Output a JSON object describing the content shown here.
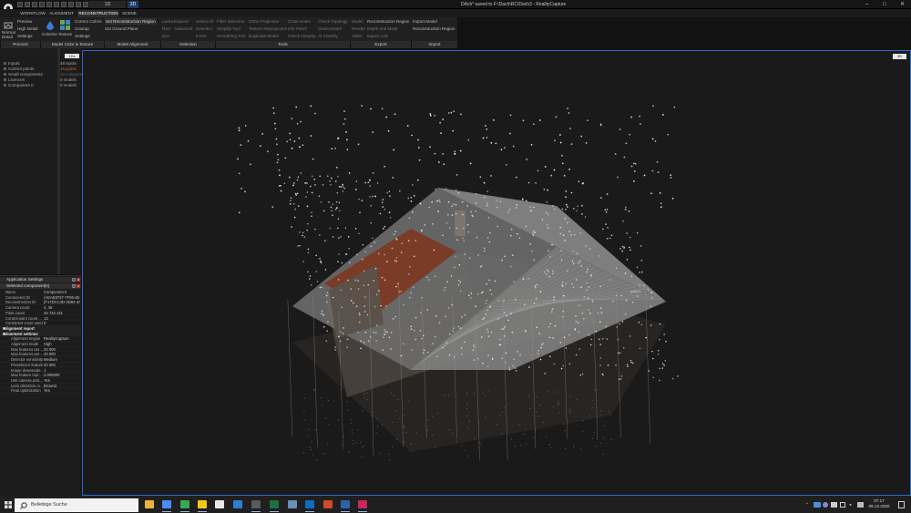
{
  "titlebar": {
    "title": "DAch* saved to F:\\Dach\\RC\\Dach3 - RealityCapture",
    "view_1d": "1D",
    "view_3d": "3D",
    "minimize": "–",
    "maximize": "□",
    "close": "✕"
  },
  "menu": {
    "tabs": [
      "WORKFLOW",
      "ALIGNMENT",
      "RECONSTRUCTION",
      "SCENE"
    ],
    "active_tab": "RECONSTRUCTION"
  },
  "ribbon": {
    "process": {
      "normal_detail": "Normal Detail",
      "preview": "Preview",
      "high_detail": "High Detail",
      "settings": "Settings",
      "group": "Process"
    },
    "model_color": {
      "colorize": "Colorize",
      "texture": "Texture",
      "correct_colors": "Correct Colors",
      "unwrap": "Unwrap",
      "settings": "Settings",
      "group": "Model Color & Texture"
    },
    "model_alignment": {
      "set_region": "Set Reconstruction Region",
      "set_ground": "Set Ground Plane",
      "group": "Model Alignment"
    },
    "selection": {
      "lasso": "Lasso",
      "rect": "Rect",
      "box": "Box",
      "expand": "Expand",
      "advanced": "Advanced",
      "select_all": "Select All",
      "deselect": "Deselect",
      "invert": "Invert",
      "group": "Selection"
    },
    "tools": {
      "filter_selection": "Filter Selection",
      "simplify_tool": "Simplify Tool",
      "smoothing_tool": "Smoothing Tool",
      "ortho_projection": "Ortho Projection",
      "texture_reprojection": "Texture Reprojection",
      "duplicate_model": "Duplicate Model",
      "close_holes": "Close Holes",
      "info_panel": "Info Panel",
      "check_integrity": "Check Integrity",
      "check_topology": "Check Topology",
      "clean_model": "Clean Model",
      "ai_classify": "AI Classify",
      "group": "Tools"
    },
    "export": {
      "model": "Model",
      "render": "Render",
      "video": "Video",
      "reconstruction_region": "Reconstruction Region",
      "depth_and_mask": "Depth and Mask",
      "export_lod": "Export LoD",
      "group": "Export"
    },
    "import": {
      "import_model": "Import Model",
      "reconstruction_region": "Reconstruction Region",
      "group": "Import"
    }
  },
  "tree": {
    "items": [
      "Inputs",
      "Control points",
      "Small components",
      "Licences",
      "Component 0"
    ],
    "counts": [
      "48 inputs",
      "15 points",
      "10 compone",
      "0 models",
      "0 models"
    ],
    "toggle": "1Ds"
  },
  "viewport": {
    "badge": "3D",
    "coord_label": "point 0"
  },
  "properties": {
    "app_settings": "Application Settings",
    "selected_component": "Selected component(s)",
    "rows": [
      {
        "k": "Name",
        "v": "Component 0"
      },
      {
        "k": "Component ID",
        "v": "{AEAE8757-7F06-4E…"
      },
      {
        "k": "Reconstruction ID",
        "v": "{F17DCC4D-4D84-4A…"
      },
      {
        "k": "Camera count",
        "v": "4, 48"
      },
      {
        "k": "Point count",
        "v": "45 734 131"
      },
      {
        "k": "Control point count …",
        "v": "13"
      },
      {
        "k": "Constraint count used",
        "v": "0"
      }
    ],
    "section_report": "Alignment report",
    "section_settings": "Alignment settings",
    "settings_rows": [
      {
        "k": "Alignment engine",
        "v": "RealityCapture"
      },
      {
        "k": "Alignment mode",
        "v": "High"
      },
      {
        "k": "Max features per…",
        "v": "20 000"
      },
      {
        "k": "Max features per…",
        "v": "40 000"
      },
      {
        "k": "Detector sensitivity",
        "v": "Medium"
      },
      {
        "k": "Preselector features",
        "v": "20 000"
      },
      {
        "k": "Image downscale …",
        "v": "1"
      },
      {
        "k": "Max feature repr…",
        "v": "2.000000"
      },
      {
        "k": "Use camera posi…",
        "v": "Yes"
      },
      {
        "k": "Lens distortion m…",
        "v": "Brown3"
      },
      {
        "k": "Final optimization",
        "v": "Yes"
      }
    ]
  },
  "taskbar": {
    "search_placeholder": "Beliebige Suche",
    "time": "07:17",
    "date": "09.12.2020",
    "icons": [
      {
        "name": "file-explorer-icon",
        "color": "#e8b33a"
      },
      {
        "name": "chrome-icon",
        "color": "#4c8bf5"
      },
      {
        "name": "chrome-profile-icon",
        "color": "#38a853"
      },
      {
        "name": "sticky-notes-icon",
        "color": "#f2c811"
      },
      {
        "name": "document-viewer-icon",
        "color": "#e8e8e8"
      },
      {
        "name": "calculator-icon",
        "color": "#2d7dd2"
      },
      {
        "name": "realitycapture-icon",
        "color": "#5a5a5a"
      },
      {
        "name": "excel-icon",
        "color": "#1d7044"
      },
      {
        "name": "network-drive-icon",
        "color": "#6a8fb8"
      },
      {
        "name": "outlook-icon",
        "color": "#0f6cbd"
      },
      {
        "name": "word-app-icon",
        "color": "#cf4a26"
      },
      {
        "name": "photoshop-icon",
        "color": "#2b62a8"
      },
      {
        "name": "indesign-icon",
        "color": "#c8285d"
      }
    ]
  },
  "colors": {
    "accent_blue": "#2f6bd9",
    "count_orange": "#d26a1a",
    "roof_red": "#8a3a22"
  }
}
